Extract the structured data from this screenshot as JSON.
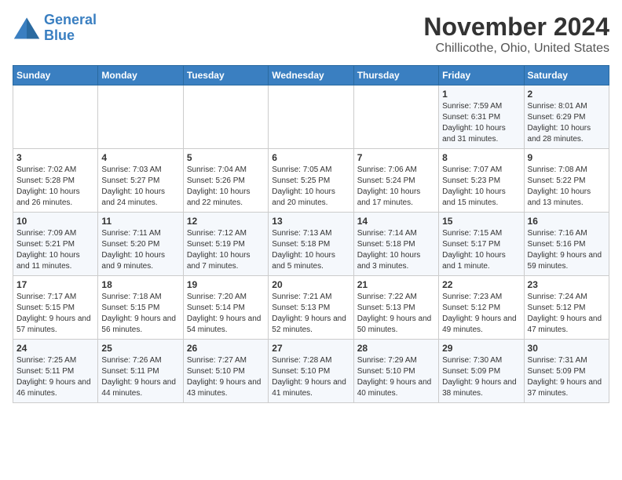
{
  "logo": {
    "line1": "General",
    "line2": "Blue"
  },
  "title": "November 2024",
  "location": "Chillicothe, Ohio, United States",
  "weekdays": [
    "Sunday",
    "Monday",
    "Tuesday",
    "Wednesday",
    "Thursday",
    "Friday",
    "Saturday"
  ],
  "weeks": [
    [
      {
        "day": "",
        "info": ""
      },
      {
        "day": "",
        "info": ""
      },
      {
        "day": "",
        "info": ""
      },
      {
        "day": "",
        "info": ""
      },
      {
        "day": "",
        "info": ""
      },
      {
        "day": "1",
        "info": "Sunrise: 7:59 AM\nSunset: 6:31 PM\nDaylight: 10 hours and 31 minutes."
      },
      {
        "day": "2",
        "info": "Sunrise: 8:01 AM\nSunset: 6:29 PM\nDaylight: 10 hours and 28 minutes."
      }
    ],
    [
      {
        "day": "3",
        "info": "Sunrise: 7:02 AM\nSunset: 5:28 PM\nDaylight: 10 hours and 26 minutes."
      },
      {
        "day": "4",
        "info": "Sunrise: 7:03 AM\nSunset: 5:27 PM\nDaylight: 10 hours and 24 minutes."
      },
      {
        "day": "5",
        "info": "Sunrise: 7:04 AM\nSunset: 5:26 PM\nDaylight: 10 hours and 22 minutes."
      },
      {
        "day": "6",
        "info": "Sunrise: 7:05 AM\nSunset: 5:25 PM\nDaylight: 10 hours and 20 minutes."
      },
      {
        "day": "7",
        "info": "Sunrise: 7:06 AM\nSunset: 5:24 PM\nDaylight: 10 hours and 17 minutes."
      },
      {
        "day": "8",
        "info": "Sunrise: 7:07 AM\nSunset: 5:23 PM\nDaylight: 10 hours and 15 minutes."
      },
      {
        "day": "9",
        "info": "Sunrise: 7:08 AM\nSunset: 5:22 PM\nDaylight: 10 hours and 13 minutes."
      }
    ],
    [
      {
        "day": "10",
        "info": "Sunrise: 7:09 AM\nSunset: 5:21 PM\nDaylight: 10 hours and 11 minutes."
      },
      {
        "day": "11",
        "info": "Sunrise: 7:11 AM\nSunset: 5:20 PM\nDaylight: 10 hours and 9 minutes."
      },
      {
        "day": "12",
        "info": "Sunrise: 7:12 AM\nSunset: 5:19 PM\nDaylight: 10 hours and 7 minutes."
      },
      {
        "day": "13",
        "info": "Sunrise: 7:13 AM\nSunset: 5:18 PM\nDaylight: 10 hours and 5 minutes."
      },
      {
        "day": "14",
        "info": "Sunrise: 7:14 AM\nSunset: 5:18 PM\nDaylight: 10 hours and 3 minutes."
      },
      {
        "day": "15",
        "info": "Sunrise: 7:15 AM\nSunset: 5:17 PM\nDaylight: 10 hours and 1 minute."
      },
      {
        "day": "16",
        "info": "Sunrise: 7:16 AM\nSunset: 5:16 PM\nDaylight: 9 hours and 59 minutes."
      }
    ],
    [
      {
        "day": "17",
        "info": "Sunrise: 7:17 AM\nSunset: 5:15 PM\nDaylight: 9 hours and 57 minutes."
      },
      {
        "day": "18",
        "info": "Sunrise: 7:18 AM\nSunset: 5:15 PM\nDaylight: 9 hours and 56 minutes."
      },
      {
        "day": "19",
        "info": "Sunrise: 7:20 AM\nSunset: 5:14 PM\nDaylight: 9 hours and 54 minutes."
      },
      {
        "day": "20",
        "info": "Sunrise: 7:21 AM\nSunset: 5:13 PM\nDaylight: 9 hours and 52 minutes."
      },
      {
        "day": "21",
        "info": "Sunrise: 7:22 AM\nSunset: 5:13 PM\nDaylight: 9 hours and 50 minutes."
      },
      {
        "day": "22",
        "info": "Sunrise: 7:23 AM\nSunset: 5:12 PM\nDaylight: 9 hours and 49 minutes."
      },
      {
        "day": "23",
        "info": "Sunrise: 7:24 AM\nSunset: 5:12 PM\nDaylight: 9 hours and 47 minutes."
      }
    ],
    [
      {
        "day": "24",
        "info": "Sunrise: 7:25 AM\nSunset: 5:11 PM\nDaylight: 9 hours and 46 minutes."
      },
      {
        "day": "25",
        "info": "Sunrise: 7:26 AM\nSunset: 5:11 PM\nDaylight: 9 hours and 44 minutes."
      },
      {
        "day": "26",
        "info": "Sunrise: 7:27 AM\nSunset: 5:10 PM\nDaylight: 9 hours and 43 minutes."
      },
      {
        "day": "27",
        "info": "Sunrise: 7:28 AM\nSunset: 5:10 PM\nDaylight: 9 hours and 41 minutes."
      },
      {
        "day": "28",
        "info": "Sunrise: 7:29 AM\nSunset: 5:10 PM\nDaylight: 9 hours and 40 minutes."
      },
      {
        "day": "29",
        "info": "Sunrise: 7:30 AM\nSunset: 5:09 PM\nDaylight: 9 hours and 38 minutes."
      },
      {
        "day": "30",
        "info": "Sunrise: 7:31 AM\nSunset: 5:09 PM\nDaylight: 9 hours and 37 minutes."
      }
    ]
  ]
}
